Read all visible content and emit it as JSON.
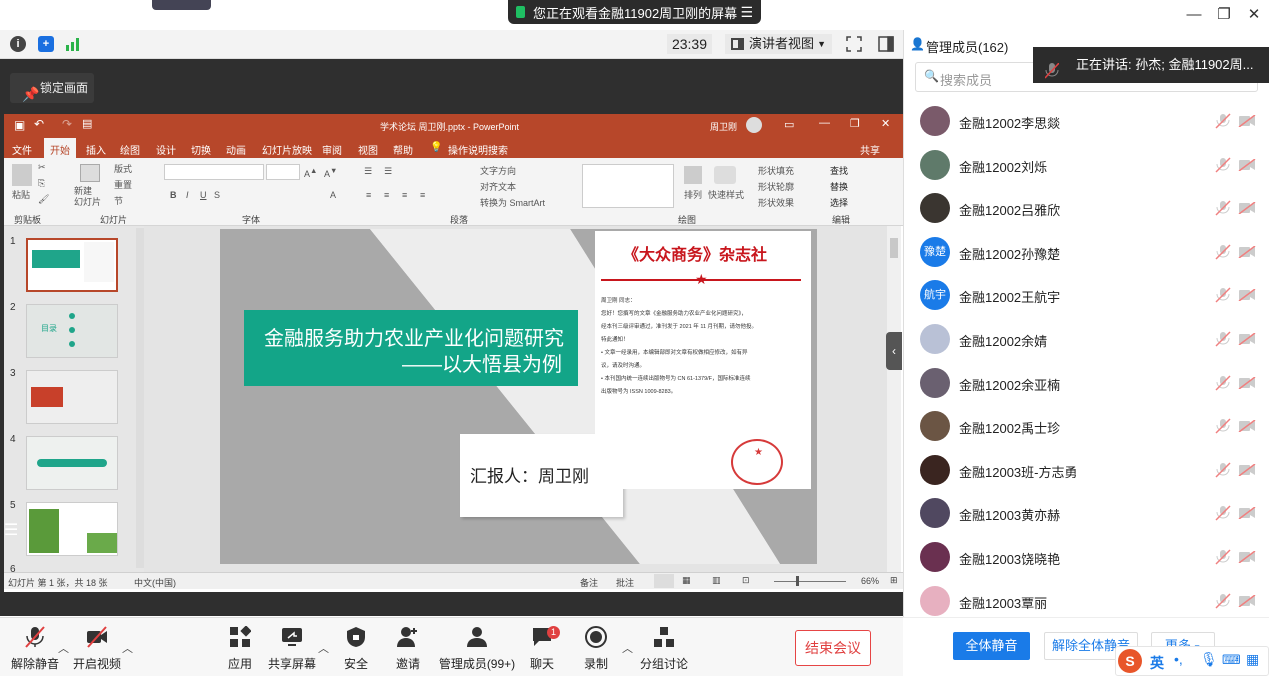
{
  "share_banner": {
    "text": "您正在观看金融11902周卫刚的屏幕"
  },
  "toolbar": {
    "timer": "23:39",
    "view_mode": "演讲者视图"
  },
  "lock": {
    "label": "锁定画面"
  },
  "ppt": {
    "title": "学术论坛 周卫刚.pptx - PowerPoint",
    "user": "周卫刚",
    "share": "共享",
    "tabs": [
      "文件",
      "开始",
      "插入",
      "绘图",
      "设计",
      "切换",
      "动画",
      "幻灯片放映",
      "审阅",
      "视图",
      "帮助",
      "操作说明搜索"
    ],
    "ribbon_groups": [
      "剪贴板",
      "幻灯片",
      "字体",
      "段落",
      "绘图",
      "编辑"
    ],
    "ribbon_items": {
      "paste": "粘贴",
      "new_slide": "新建\n幻灯片",
      "layout": "版式",
      "reset": "重置",
      "section": "节",
      "text_dir": "文字方向",
      "align_text": "对齐文本",
      "smartart": "转换为 SmartArt",
      "arrange": "排列",
      "quick_styles": "快速样式",
      "shape_fill": "形状填充",
      "shape_outline": "形状轮廓",
      "shape_effects": "形状效果",
      "find": "查找",
      "replace": "替换",
      "select": "选择"
    },
    "thumb_numbers": [
      "1",
      "2",
      "3",
      "4",
      "5",
      "6"
    ],
    "thumb2_label": "目录",
    "slide": {
      "title_line1": "金融服务助力农业产业化问题研究",
      "title_line2": "——以大悟县为例",
      "reporter": "汇报人：周卫刚",
      "doc_title": "《大众商务》杂志社",
      "doc_lines": [
        "周卫刚  同志：",
        "您好！您撰写的文章《金融服务助力农业产业化问题研究》，",
        "经本刊三级评审通过，准刊发于  2021  年  11  月刊期，请勿他投。",
        "特此通知！",
        "• 文章一经录用，本编辑部即对文章有权做相应修改，如有异",
        "议，请及时沟通。",
        "• 本刊国内统一连续出版物号为 CN 61-1379/F，国际标准连续",
        "出版物号为 ISSN 1009-8283。"
      ],
      "seal_text": "《大众商务》杂志社"
    },
    "status": {
      "slide_info": "幻灯片 第 1 张，共 18 张",
      "language": "中文(中国)",
      "notes": "备注",
      "comments": "批注",
      "zoom": "66%"
    }
  },
  "panel": {
    "title": "管理成员(162)",
    "search_placeholder": "搜索成员",
    "speaking": "正在讲话: 孙杰; 金融11902周...",
    "members": [
      {
        "name": "金融12002李思燚",
        "avatar": "",
        "color": "#7a5a6a"
      },
      {
        "name": "金融12002刘烁",
        "avatar": "",
        "color": "#5f7a6a"
      },
      {
        "name": "金融12002吕雅欣",
        "avatar": "",
        "color": "#3a3530"
      },
      {
        "name": "金融12002孙豫楚",
        "avatar": "豫楚",
        "color": "#1a7be8"
      },
      {
        "name": "金融12002王航宇",
        "avatar": "航宇",
        "color": "#1a7be8"
      },
      {
        "name": "金融12002余婧",
        "avatar": "",
        "color": "#b9c1d6"
      },
      {
        "name": "金融12002余亚楠",
        "avatar": "",
        "color": "#6a6070"
      },
      {
        "name": "金融12002禹士珍",
        "avatar": "",
        "color": "#6b5544"
      },
      {
        "name": "金融12003班-方志勇",
        "avatar": "",
        "color": "#3a2520"
      },
      {
        "name": "金融12003黄亦赫",
        "avatar": "",
        "color": "#504860"
      },
      {
        "name": "金融12003饶晓艳",
        "avatar": "",
        "color": "#6a3050"
      },
      {
        "name": "金融12003覃丽",
        "avatar": "",
        "color": "#e7b0c0"
      }
    ],
    "mute_all": "全体静音",
    "unmute_all": "解除全体静音",
    "more": "更多",
    "ime": "英"
  },
  "bottombar": {
    "unmute": "解除静音",
    "video": "开启视频",
    "apps": "应用",
    "share_screen": "共享屏幕",
    "security": "安全",
    "invite": "邀请",
    "members": "管理成员(99+)",
    "chat": "聊天",
    "chat_badge": "1",
    "record": "录制",
    "breakout": "分组讨论",
    "end": "结束会议"
  }
}
